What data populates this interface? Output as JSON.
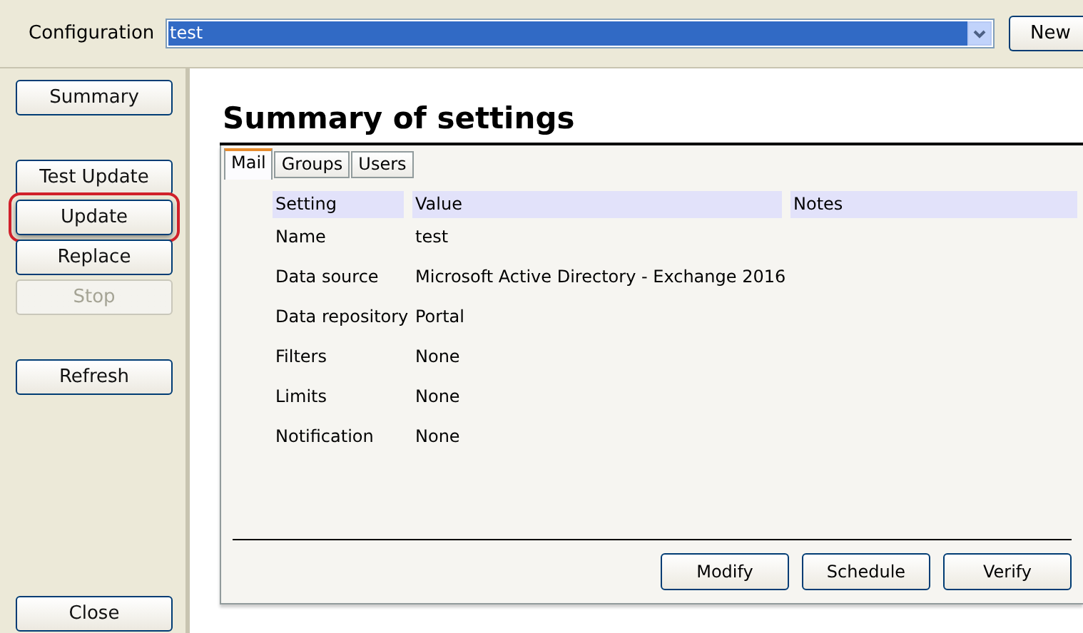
{
  "toolbar": {
    "label": "Configuration",
    "configuration": "test",
    "new_button": "New"
  },
  "sidebar": {
    "groups": [
      [
        {
          "label": "Summary",
          "disabled": false,
          "highlighted": false
        }
      ],
      [
        {
          "label": "Test Update",
          "disabled": false,
          "highlighted": false
        },
        {
          "label": "Update",
          "disabled": false,
          "highlighted": true
        },
        {
          "label": "Replace",
          "disabled": false,
          "highlighted": false
        },
        {
          "label": "Stop",
          "disabled": true,
          "highlighted": false
        }
      ],
      [
        {
          "label": "Refresh",
          "disabled": false,
          "highlighted": false
        }
      ]
    ],
    "close_button": "Close"
  },
  "main": {
    "heading": "Summary of settings",
    "tabs": [
      {
        "label": "Mail",
        "selected": true
      },
      {
        "label": "Groups",
        "selected": false
      },
      {
        "label": "Users",
        "selected": false
      }
    ],
    "table": {
      "columns": [
        "Setting",
        "Value",
        "Notes"
      ],
      "rows": [
        [
          "Name",
          "test"
        ],
        [
          "Data source",
          "Microsoft Active Directory - Exchange 2016"
        ],
        [
          "Data repository",
          "Portal"
        ],
        [
          "Filters",
          "None"
        ],
        [
          "Limits",
          "None"
        ],
        [
          "Notification",
          "None"
        ]
      ]
    },
    "buttons": [
      "Modify",
      "Schedule",
      "Verify"
    ]
  }
}
